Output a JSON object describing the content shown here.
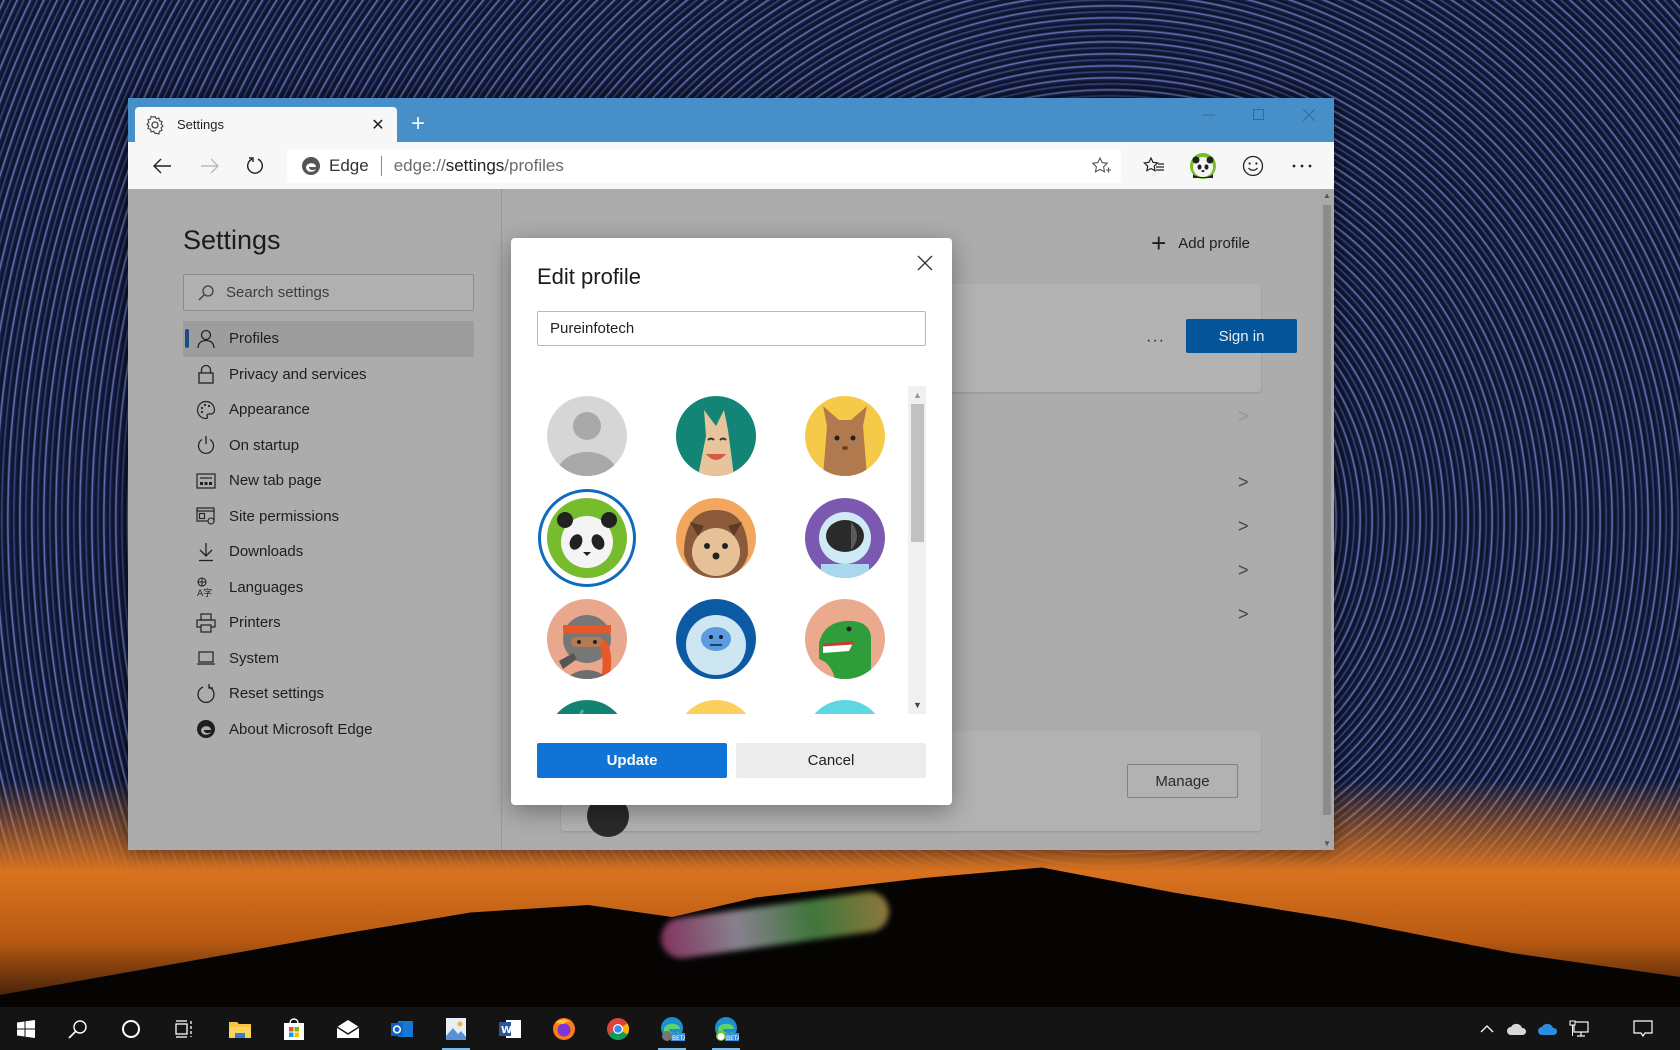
{
  "browser": {
    "tab": {
      "title": "Settings",
      "icon": "gear-icon"
    },
    "new_tab_label": "+",
    "window_controls": [
      "minimize",
      "maximize",
      "close"
    ],
    "address": {
      "site_name": "Edge",
      "url_prefix": "edge://",
      "url_host": "settings",
      "url_suffix": "/profiles"
    },
    "toolbar_icons": [
      "favorite-star-icon",
      "favorites-list-icon",
      "profile-avatar-icon",
      "feedback-smiley-icon",
      "more-menu-icon"
    ]
  },
  "sidebar": {
    "title": "Settings",
    "search_placeholder": "Search settings",
    "items": [
      {
        "label": "Profiles",
        "icon": "person-icon",
        "active": true
      },
      {
        "label": "Privacy and services",
        "icon": "lock-icon"
      },
      {
        "label": "Appearance",
        "icon": "palette-icon"
      },
      {
        "label": "On startup",
        "icon": "power-icon"
      },
      {
        "label": "New tab page",
        "icon": "new-tab-page-icon"
      },
      {
        "label": "Site permissions",
        "icon": "site-permissions-icon"
      },
      {
        "label": "Downloads",
        "icon": "download-icon"
      },
      {
        "label": "Languages",
        "icon": "languages-icon"
      },
      {
        "label": "Printers",
        "icon": "printer-icon"
      },
      {
        "label": "System",
        "icon": "laptop-icon"
      },
      {
        "label": "Reset settings",
        "icon": "reset-icon"
      },
      {
        "label": "About Microsoft Edge",
        "icon": "edge-logo-icon"
      }
    ]
  },
  "main": {
    "add_profile_label": "Add profile",
    "more_label": "···",
    "sign_in_label": "Sign in",
    "manage_label": "Manage",
    "row_chevrons": 5
  },
  "dialog": {
    "title": "Edit profile",
    "name_value": "Pureinfotech",
    "avatars": [
      {
        "name": "default-person",
        "bg": "#d6d6d6",
        "selected": false
      },
      {
        "name": "dog",
        "bg": "#138576",
        "selected": false
      },
      {
        "name": "cat",
        "bg": "#f7c948",
        "selected": false
      },
      {
        "name": "panda",
        "bg": "#76bc2c",
        "selected": true
      },
      {
        "name": "hedgehog",
        "bg": "#f2a65e",
        "selected": false
      },
      {
        "name": "astronaut",
        "bg": "#7b59b0",
        "selected": false
      },
      {
        "name": "ninja",
        "bg": "#e9a78e",
        "selected": false
      },
      {
        "name": "yeti",
        "bg": "#0b5aa3",
        "selected": false
      },
      {
        "name": "dinosaur",
        "bg": "#eba98e",
        "selected": false
      },
      {
        "name": "teal-avatar",
        "bg": "#128272",
        "selected": false
      },
      {
        "name": "yellow-avatar",
        "bg": "#fbcf5b",
        "selected": false
      },
      {
        "name": "cyan-avatar",
        "bg": "#5cd7e3",
        "selected": false
      }
    ],
    "update_label": "Update",
    "cancel_label": "Cancel",
    "accent": "#0f74d6"
  },
  "taskbar": {
    "apps": [
      {
        "name": "start",
        "icon": "windows-start-icon"
      },
      {
        "name": "search",
        "icon": "search-icon"
      },
      {
        "name": "cortana",
        "icon": "cortana-icon"
      },
      {
        "name": "task-view",
        "icon": "task-view-icon"
      },
      {
        "name": "file-explorer",
        "icon": "folder-icon"
      },
      {
        "name": "store",
        "icon": "store-icon"
      },
      {
        "name": "mail",
        "icon": "mail-icon"
      },
      {
        "name": "outlook",
        "icon": "outlook-icon"
      },
      {
        "name": "photos",
        "icon": "photos-icon",
        "running": true
      },
      {
        "name": "word",
        "icon": "word-icon"
      },
      {
        "name": "firefox",
        "icon": "firefox-icon"
      },
      {
        "name": "chrome",
        "icon": "chrome-icon"
      },
      {
        "name": "edge-beta-1",
        "icon": "edge-beta-icon",
        "running": true
      },
      {
        "name": "edge-beta-2",
        "icon": "edge-beta-icon",
        "running": true
      }
    ],
    "tray": [
      "chevron-up-icon",
      "onedrive-gray-icon",
      "onedrive-blue-icon",
      "network-icon",
      "action-center-icon"
    ]
  }
}
